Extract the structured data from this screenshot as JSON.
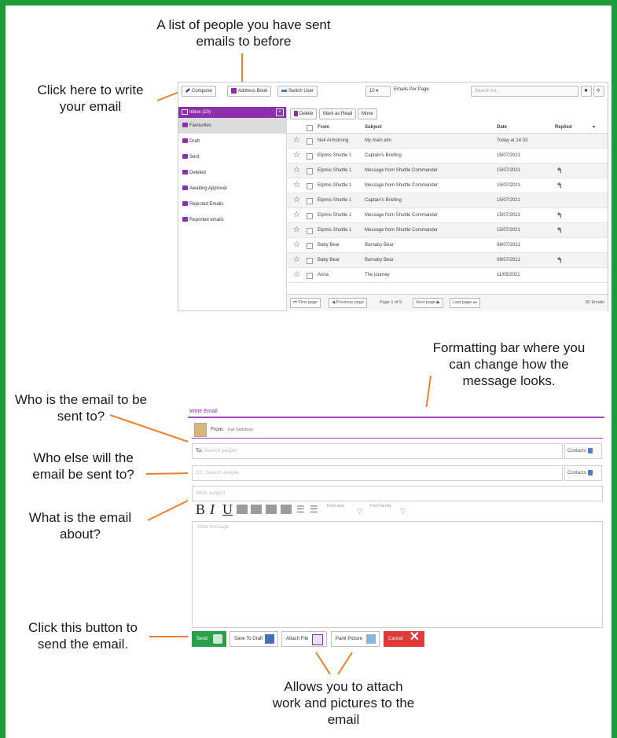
{
  "callouts": {
    "people_list": "A list of people you have sent emails to before",
    "write_email": "Click here to write your email",
    "formatting": "Formatting bar where you can change how the message looks.",
    "sent_to": "Who is the email to be sent to?",
    "else_sent": "Who else will the email be sent to?",
    "about": "What is the email about?",
    "send_btn": "Click this button to send the email.",
    "attach": "Allows you to attach work and pictures to the email"
  },
  "toolbar": {
    "compose": "Compose",
    "address_book": "Address Book",
    "switch_user": "Switch User",
    "per_page_value": "10",
    "per_page_label": "Emails Per Page",
    "search_placeholder": "Search for..."
  },
  "sidebar": {
    "inbox": "Inbox (10)",
    "items": [
      {
        "label": "Favourites"
      },
      {
        "label": "Draft"
      },
      {
        "label": "Sent"
      },
      {
        "label": "Deleted"
      },
      {
        "label": "Awaiting Approval"
      },
      {
        "label": "Rejected Emails"
      },
      {
        "label": "Reported emails"
      }
    ]
  },
  "actions": {
    "delete": "Delete",
    "mark_read": "Mark as Read",
    "move": "Move"
  },
  "table": {
    "headers": {
      "from": "From",
      "subject": "Subject",
      "date": "Date",
      "replied": "Replied"
    },
    "rows": [
      {
        "from": "Neil Armstrong",
        "subject": "My main aim",
        "date": "Today at 14:03",
        "replied": false
      },
      {
        "from": "Elpmis Shuttle 1",
        "subject": "Captain's Briefing",
        "date": "15/07/2021",
        "replied": false
      },
      {
        "from": "Elpmis Shuttle 1",
        "subject": "Message from Shuttle Commander",
        "date": "15/07/2021",
        "replied": true
      },
      {
        "from": "Elpmis Shuttle 1",
        "subject": "Message from Shuttle Commander",
        "date": "15/07/2021",
        "replied": true
      },
      {
        "from": "Elpmis Shuttle 1",
        "subject": "Captain's Briefing",
        "date": "15/07/2021",
        "replied": false
      },
      {
        "from": "Elpmis Shuttle 1",
        "subject": "Message from Shuttle Commander",
        "date": "15/07/2021",
        "replied": true
      },
      {
        "from": "Elpmis Shuttle 1",
        "subject": "Message from Shuttle Commander",
        "date": "15/07/2021",
        "replied": true
      },
      {
        "from": "Baby Bear",
        "subject": "Barnaby Bear",
        "date": "08/07/2021",
        "replied": false
      },
      {
        "from": "Baby Bear",
        "subject": "Barnaby Bear",
        "date": "08/07/2021",
        "replied": true
      },
      {
        "from": "Anna",
        "subject": "The journey",
        "date": "11/05/2021",
        "replied": false
      }
    ]
  },
  "pager": {
    "first": "First page",
    "prev": "Previous page",
    "info": "Page 1 of 9",
    "next": "Next page",
    "last": "Last page",
    "count": "82 Emails"
  },
  "compose": {
    "title": "Write Email",
    "from_label": "From:",
    "from_value": "Kat Salisbury",
    "to_label": "To:",
    "to_placeholder": "Search people",
    "cc_label": "CC:",
    "cc_placeholder": "Search people",
    "contacts": "Contacts",
    "subject_placeholder": "Write subject",
    "message_placeholder": "Write message",
    "font_size": "Font size",
    "font_family": "Font family",
    "send": "Send",
    "save_draft": "Save To Draft",
    "attach_file": "Attach File",
    "paint_picture": "Paint Picture",
    "cancel": "Cancel"
  },
  "colors": {
    "frame": "#1f9b3a",
    "accent": "#8e2fab",
    "callout_line": "#f07f2a",
    "send": "#2aa04a",
    "cancel": "#e03a3a"
  }
}
